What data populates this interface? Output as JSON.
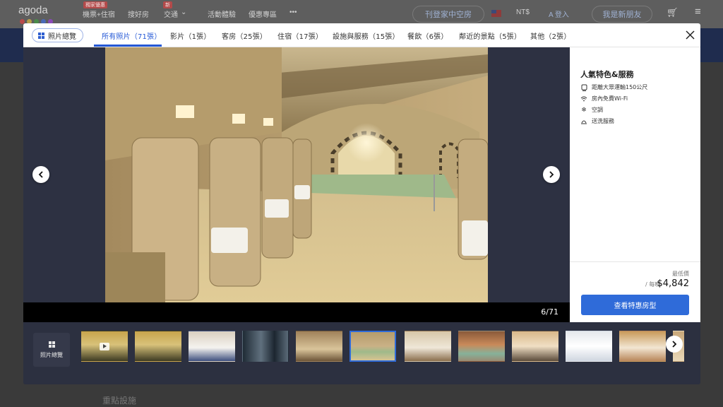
{
  "background": {
    "logo": "agoda",
    "nav": [
      {
        "label": "機票+住宿",
        "badge": "獨家優惠"
      },
      {
        "label": "搜好房",
        "badge": ""
      },
      {
        "label": "交通",
        "badge": "新"
      },
      {
        "label": "活動體驗",
        "badge": ""
      },
      {
        "label": "優惠專區",
        "badge": ""
      },
      {
        "label": "•••",
        "badge": ""
      }
    ],
    "list_property": "刊登家中空房",
    "currency": "NT$",
    "login": "A 登入",
    "signup": "我是新朋友",
    "section_heading": "重點設施"
  },
  "modal": {
    "overview_label": "照片總覽",
    "tabs": [
      {
        "label": "所有照片（71張）",
        "active": true
      },
      {
        "label": "影片（1張）",
        "active": false
      },
      {
        "label": "客房（25張）",
        "active": false
      },
      {
        "label": "住宿（17張）",
        "active": false
      },
      {
        "label": "設施與服務（15張）",
        "active": false
      },
      {
        "label": "餐飲（6張）",
        "active": false
      },
      {
        "label": "鄰近的景點（5張）",
        "active": false
      },
      {
        "label": "其他（2張）",
        "active": false
      }
    ],
    "counter": "6/71",
    "side": {
      "title": "人氣特色&服務",
      "features": [
        {
          "icon": "transit-icon",
          "label": "距離大眾運輸150公尺"
        },
        {
          "icon": "wifi-icon",
          "label": "房內免費Wi-Fi"
        },
        {
          "icon": "snowflake-icon",
          "label": "空調"
        },
        {
          "icon": "bell-service-icon",
          "label": "送洗服務"
        }
      ],
      "lowest_label": "最低價",
      "per_night": "/ 每晚",
      "price": "$4,842",
      "cta": "查看特惠房型"
    },
    "thumbnails_overview": "照片總覽",
    "selected_thumbnail": 6
  },
  "colors": {
    "accent": "#2458d6",
    "cta": "#2f6bd9",
    "modal_dark": "#2c3040"
  }
}
